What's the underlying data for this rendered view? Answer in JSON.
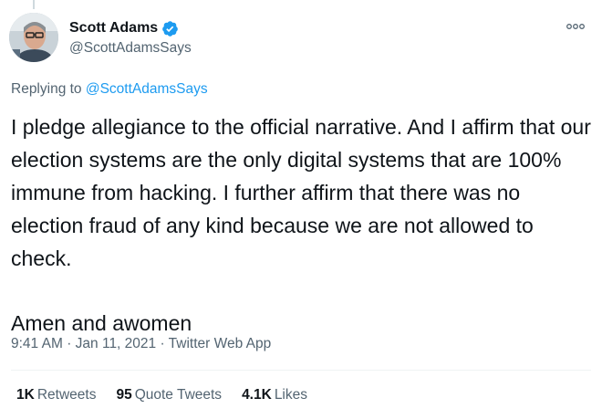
{
  "author": {
    "display_name": "Scott Adams",
    "handle": "@ScottAdamsSays",
    "verified": true,
    "verified_color": "#1d9bf0"
  },
  "reply": {
    "prefix": "Replying to",
    "to_handle": "@ScottAdamsSays"
  },
  "tweet": {
    "paragraphs": [
      "I pledge allegiance to the official narrative. And I affirm that our election systems are the only digital systems that are 100% immune from hacking. I further affirm that there was no election fraud of any kind because we are not allowed to check.",
      "Amen and awomen"
    ]
  },
  "meta": {
    "time": "9:41 AM",
    "separator": "·",
    "date": "Jan 11, 2021",
    "source": "Twitter Web App"
  },
  "stats": {
    "retweets_count": "1K",
    "retweets_label": "Retweets",
    "quotes_count": "95",
    "quotes_label": "Quote Tweets",
    "likes_count": "4.1K",
    "likes_label": "Likes"
  },
  "icons": {
    "verified": "verified-badge-icon",
    "more": "more-options-icon"
  },
  "colors": {
    "link": "#1d9bf0",
    "secondary_text": "#536471",
    "primary_text": "#0f1419"
  }
}
